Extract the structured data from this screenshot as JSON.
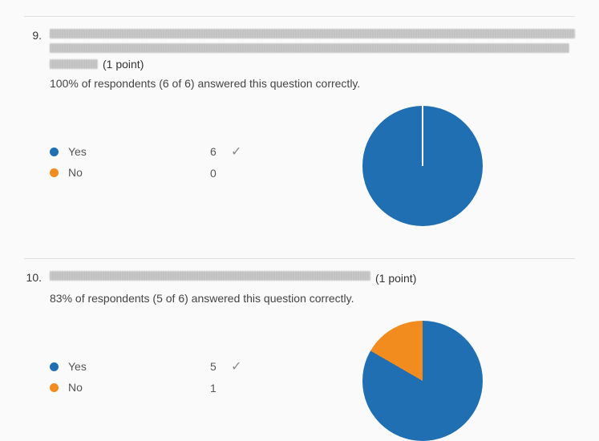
{
  "questions": [
    {
      "number": "9.",
      "points_label": "(1 point)",
      "summary": "100% of respondents (6 of 6) answered this question correctly.",
      "options": [
        {
          "label": "Yes",
          "count": "6",
          "correct": true,
          "color": "#1f6fb2"
        },
        {
          "label": "No",
          "count": "0",
          "correct": false,
          "color": "#f28c1f"
        }
      ],
      "redacted_lines": 3
    },
    {
      "number": "10.",
      "points_label": "(1 point)",
      "summary": "83% of respondents (5 of 6) answered this question correctly.",
      "options": [
        {
          "label": "Yes",
          "count": "5",
          "correct": true,
          "color": "#1f6fb2"
        },
        {
          "label": "No",
          "count": "1",
          "correct": false,
          "color": "#f28c1f"
        }
      ],
      "redacted_lines": 1
    }
  ],
  "chart_data": [
    {
      "type": "pie",
      "title": "Question 9 responses",
      "series": [
        {
          "name": "Yes",
          "value": 6,
          "color": "#1f6fb2"
        },
        {
          "name": "No",
          "value": 0,
          "color": "#f28c1f"
        }
      ]
    },
    {
      "type": "pie",
      "title": "Question 10 responses",
      "series": [
        {
          "name": "Yes",
          "value": 5,
          "color": "#1f6fb2"
        },
        {
          "name": "No",
          "value": 1,
          "color": "#f28c1f"
        }
      ]
    }
  ]
}
